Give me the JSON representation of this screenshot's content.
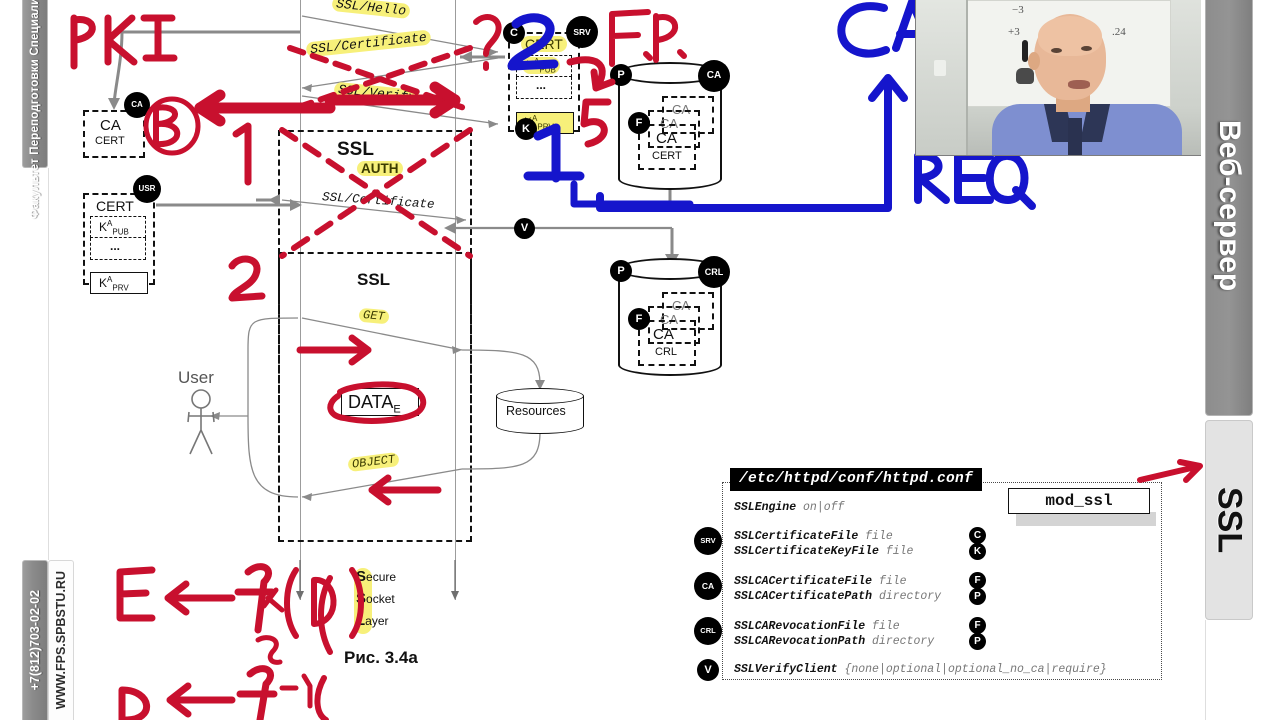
{
  "sidebars": {
    "faculty_tab": "Факультет Переподготовки Специалистов СПб",
    "phone_tab": "+7(812)703-02-02",
    "site_tab": "WWW.FPS.SPBSTU.RU",
    "webserver_tab": "Веб-сервер",
    "ssl_tab": "SSL"
  },
  "diagram": {
    "figure_caption": "Рис. 3.4а",
    "ssl_expansion": [
      {
        "letter": "S",
        "rest": "ecure"
      },
      {
        "letter": "S",
        "rest": "ocket"
      },
      {
        "letter": "L",
        "rest": "ayer"
      }
    ],
    "user_label": "User",
    "ca_cert_box": {
      "line1": "CA",
      "line2": "CERT",
      "badge": "CA"
    },
    "user_cert_box": {
      "title": "CERT",
      "pub_key": "K",
      "pub_sup": "A",
      "pub_sub": "PUB",
      "ellipsis": "...",
      "prv_key": "K",
      "prv_sup": "A",
      "prv_sub": "PRV",
      "badge": "USR"
    },
    "srv_cert_box": {
      "title": "CERT",
      "pub_key": "K",
      "pub_sup": "A",
      "pub_sub": "PUB",
      "ellipsis": "...",
      "prv_key": "K",
      "prv_sup": "A",
      "prv_sub": "PRV",
      "badge_srv": "SRV",
      "badge_c": "C",
      "badge_k": "K"
    },
    "messages": {
      "hello": "SSL/Hello",
      "certificate_top": "SSL/Certificate",
      "certificate_auth": "SSL/Certificate",
      "verify": "SSL/Verify",
      "get": "GET",
      "object": "OBJECT"
    },
    "ssl_auth_block": {
      "title": "SSL",
      "sub": "AUTH"
    },
    "ssl_block": {
      "title": "SSL"
    },
    "data_box": {
      "main": "DATA",
      "sub": "E"
    },
    "resources_label": "Resources",
    "ca_store": {
      "line1": "CA",
      "line2": "CERT",
      "badge_p": "P",
      "badge_ca": "CA",
      "badge_f": "F",
      "ghost1": "CA",
      "ghost2": "CA"
    },
    "crl_store": {
      "line1": "CA",
      "line2": "CRL",
      "badge_p": "P",
      "badge_crl": "CRL",
      "badge_f": "F",
      "ghost1": "CA",
      "ghost2": "CA"
    },
    "verify_badge": "V"
  },
  "config": {
    "title": "/etc/httpd/conf/httpd.conf",
    "module_box": "mod_ssl",
    "groups": [
      {
        "badge": "",
        "lines": [
          {
            "directive": "SSLEngine",
            "value": "on|off"
          }
        ],
        "markers": []
      },
      {
        "badge": "SRV",
        "lines": [
          {
            "directive": "SSLCertificateFile",
            "value": "file"
          },
          {
            "directive": "SSLCertificateKeyFile",
            "value": "file"
          }
        ],
        "markers": [
          "C",
          "K"
        ]
      },
      {
        "badge": "CA",
        "lines": [
          {
            "directive": "SSLCACertificateFile",
            "value": "file"
          },
          {
            "directive": "SSLCACertificatePath",
            "value": "directory"
          }
        ],
        "markers": [
          "F",
          "P"
        ]
      },
      {
        "badge": "CRL",
        "lines": [
          {
            "directive": "SSLCARevocationFile",
            "value": "file"
          },
          {
            "directive": "SSLCARevocationPath",
            "value": "directory"
          }
        ],
        "markers": [
          "F",
          "P"
        ]
      },
      {
        "badge": "V",
        "lines": [
          {
            "directive": "SSLVerifyClient",
            "value": "{none|optional|optional_no_ca|require}"
          }
        ],
        "markers": []
      }
    ]
  },
  "annotations": {
    "red": {
      "pki": "PKI",
      "fp": "F.P.",
      "num1": "1",
      "num2": "2",
      "num5": "5",
      "question": "?",
      "circled_b": "B",
      "formula1": "E ← f    (D)",
      "formula1_sub": "Ks",
      "formula2": "D ← f   (E)",
      "formula2_sup": "-1"
    },
    "blue": {
      "ca": "CA",
      "req": "REQ",
      "num2": "2",
      "num1": "1"
    }
  },
  "colors": {
    "red_ink": "#c8102e",
    "dark_red_ink": "#a31621",
    "blue_ink": "#1515cc",
    "highlight": "#f7f07a",
    "tab_gray": "#8b8b8b",
    "line_gray": "#8a8a8a"
  }
}
